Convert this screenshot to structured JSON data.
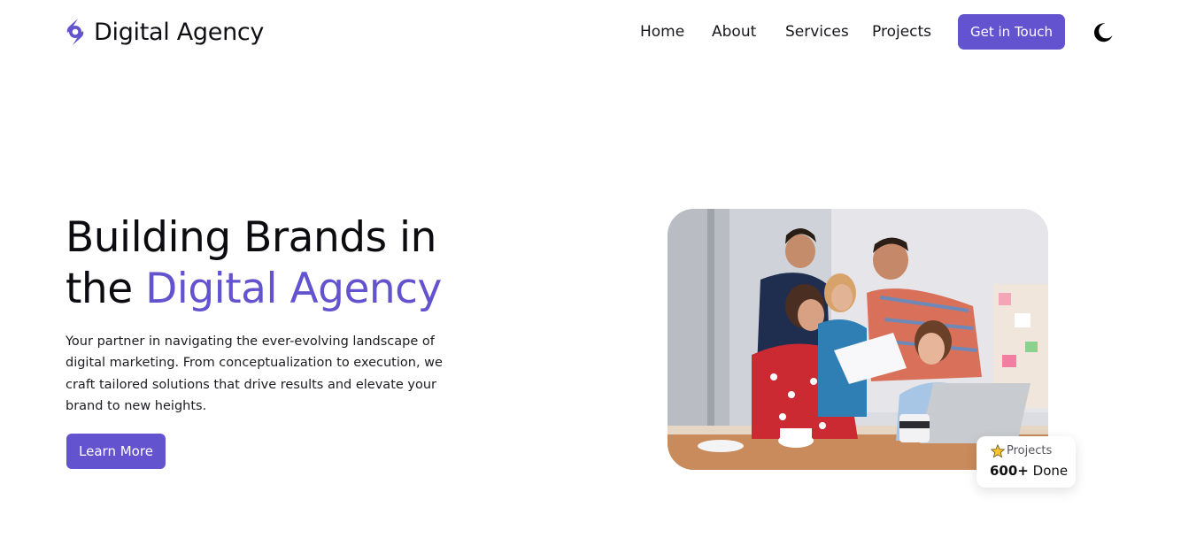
{
  "brand": {
    "name": "Digital Agency",
    "accent_color": "#6353cf",
    "logo_icon": "brand-logo-icon"
  },
  "nav": {
    "links": [
      "Home",
      "About",
      "Services",
      "Projects"
    ],
    "cta_label": "Get in Touch",
    "theme_icon": "moon-icon"
  },
  "hero": {
    "title_line1": "Building Brands in",
    "title_line2_prefix": "the",
    "title_accent": "Digital Agency",
    "description": "Your partner in navigating the ever-evolving landscape of digital marketing. From conceptualization to execution, we craft tailored solutions that drive results and elevate your brand to new heights.",
    "button_label": "Learn More",
    "image_alt": "team-meeting-photo"
  },
  "stat": {
    "icon": "star-icon",
    "label": "Projects",
    "value": "600+",
    "suffix": "Done"
  }
}
